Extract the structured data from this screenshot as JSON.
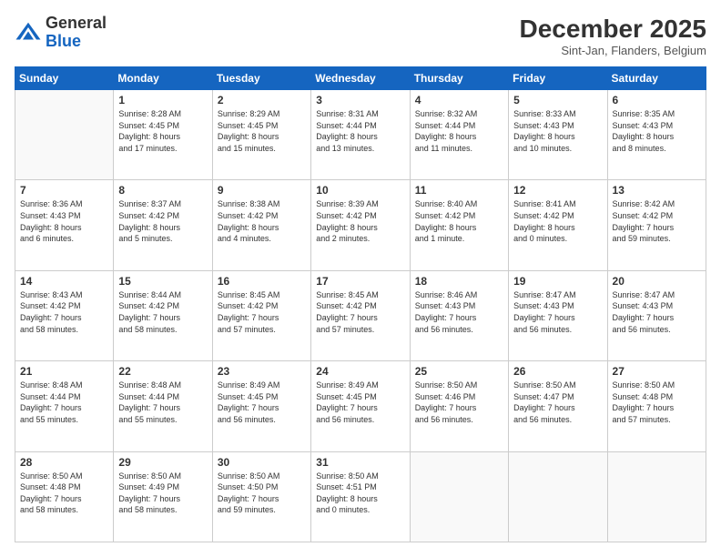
{
  "header": {
    "logo_line1": "General",
    "logo_line2": "Blue",
    "month": "December 2025",
    "location": "Sint-Jan, Flanders, Belgium"
  },
  "days_of_week": [
    "Sunday",
    "Monday",
    "Tuesday",
    "Wednesday",
    "Thursday",
    "Friday",
    "Saturday"
  ],
  "weeks": [
    [
      {
        "day": "",
        "info": ""
      },
      {
        "day": "1",
        "info": "Sunrise: 8:28 AM\nSunset: 4:45 PM\nDaylight: 8 hours\nand 17 minutes."
      },
      {
        "day": "2",
        "info": "Sunrise: 8:29 AM\nSunset: 4:45 PM\nDaylight: 8 hours\nand 15 minutes."
      },
      {
        "day": "3",
        "info": "Sunrise: 8:31 AM\nSunset: 4:44 PM\nDaylight: 8 hours\nand 13 minutes."
      },
      {
        "day": "4",
        "info": "Sunrise: 8:32 AM\nSunset: 4:44 PM\nDaylight: 8 hours\nand 11 minutes."
      },
      {
        "day": "5",
        "info": "Sunrise: 8:33 AM\nSunset: 4:43 PM\nDaylight: 8 hours\nand 10 minutes."
      },
      {
        "day": "6",
        "info": "Sunrise: 8:35 AM\nSunset: 4:43 PM\nDaylight: 8 hours\nand 8 minutes."
      }
    ],
    [
      {
        "day": "7",
        "info": "Sunrise: 8:36 AM\nSunset: 4:43 PM\nDaylight: 8 hours\nand 6 minutes."
      },
      {
        "day": "8",
        "info": "Sunrise: 8:37 AM\nSunset: 4:42 PM\nDaylight: 8 hours\nand 5 minutes."
      },
      {
        "day": "9",
        "info": "Sunrise: 8:38 AM\nSunset: 4:42 PM\nDaylight: 8 hours\nand 4 minutes."
      },
      {
        "day": "10",
        "info": "Sunrise: 8:39 AM\nSunset: 4:42 PM\nDaylight: 8 hours\nand 2 minutes."
      },
      {
        "day": "11",
        "info": "Sunrise: 8:40 AM\nSunset: 4:42 PM\nDaylight: 8 hours\nand 1 minute."
      },
      {
        "day": "12",
        "info": "Sunrise: 8:41 AM\nSunset: 4:42 PM\nDaylight: 8 hours\nand 0 minutes."
      },
      {
        "day": "13",
        "info": "Sunrise: 8:42 AM\nSunset: 4:42 PM\nDaylight: 7 hours\nand 59 minutes."
      }
    ],
    [
      {
        "day": "14",
        "info": "Sunrise: 8:43 AM\nSunset: 4:42 PM\nDaylight: 7 hours\nand 58 minutes."
      },
      {
        "day": "15",
        "info": "Sunrise: 8:44 AM\nSunset: 4:42 PM\nDaylight: 7 hours\nand 58 minutes."
      },
      {
        "day": "16",
        "info": "Sunrise: 8:45 AM\nSunset: 4:42 PM\nDaylight: 7 hours\nand 57 minutes."
      },
      {
        "day": "17",
        "info": "Sunrise: 8:45 AM\nSunset: 4:42 PM\nDaylight: 7 hours\nand 57 minutes."
      },
      {
        "day": "18",
        "info": "Sunrise: 8:46 AM\nSunset: 4:43 PM\nDaylight: 7 hours\nand 56 minutes."
      },
      {
        "day": "19",
        "info": "Sunrise: 8:47 AM\nSunset: 4:43 PM\nDaylight: 7 hours\nand 56 minutes."
      },
      {
        "day": "20",
        "info": "Sunrise: 8:47 AM\nSunset: 4:43 PM\nDaylight: 7 hours\nand 56 minutes."
      }
    ],
    [
      {
        "day": "21",
        "info": "Sunrise: 8:48 AM\nSunset: 4:44 PM\nDaylight: 7 hours\nand 55 minutes."
      },
      {
        "day": "22",
        "info": "Sunrise: 8:48 AM\nSunset: 4:44 PM\nDaylight: 7 hours\nand 55 minutes."
      },
      {
        "day": "23",
        "info": "Sunrise: 8:49 AM\nSunset: 4:45 PM\nDaylight: 7 hours\nand 56 minutes."
      },
      {
        "day": "24",
        "info": "Sunrise: 8:49 AM\nSunset: 4:45 PM\nDaylight: 7 hours\nand 56 minutes."
      },
      {
        "day": "25",
        "info": "Sunrise: 8:50 AM\nSunset: 4:46 PM\nDaylight: 7 hours\nand 56 minutes."
      },
      {
        "day": "26",
        "info": "Sunrise: 8:50 AM\nSunset: 4:47 PM\nDaylight: 7 hours\nand 56 minutes."
      },
      {
        "day": "27",
        "info": "Sunrise: 8:50 AM\nSunset: 4:48 PM\nDaylight: 7 hours\nand 57 minutes."
      }
    ],
    [
      {
        "day": "28",
        "info": "Sunrise: 8:50 AM\nSunset: 4:48 PM\nDaylight: 7 hours\nand 58 minutes."
      },
      {
        "day": "29",
        "info": "Sunrise: 8:50 AM\nSunset: 4:49 PM\nDaylight: 7 hours\nand 58 minutes."
      },
      {
        "day": "30",
        "info": "Sunrise: 8:50 AM\nSunset: 4:50 PM\nDaylight: 7 hours\nand 59 minutes."
      },
      {
        "day": "31",
        "info": "Sunrise: 8:50 AM\nSunset: 4:51 PM\nDaylight: 8 hours\nand 0 minutes."
      },
      {
        "day": "",
        "info": ""
      },
      {
        "day": "",
        "info": ""
      },
      {
        "day": "",
        "info": ""
      }
    ]
  ]
}
